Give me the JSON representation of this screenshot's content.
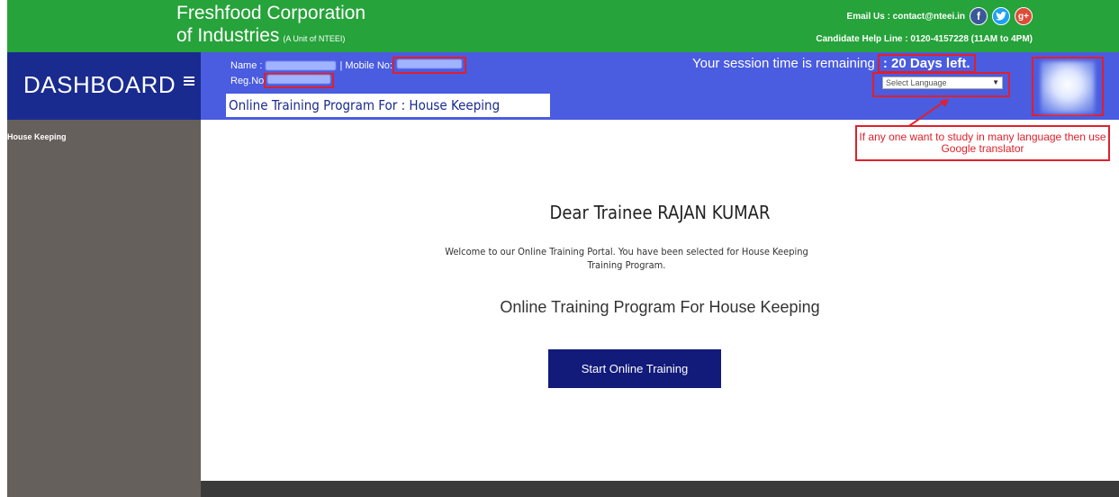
{
  "brand": {
    "line1": "Freshfood Corporation",
    "line2": "of Industries",
    "unit": "(A Unit of NTEEI)"
  },
  "contact": {
    "email": "Email Us : contact@nteei.in",
    "helpline": "Candidate Help Line : 0120-4157228 (11AM to 4PM)",
    "social_icons": [
      "facebook-icon",
      "twitter-icon",
      "google-plus-icon"
    ]
  },
  "header": {
    "dashboard_title": "DASHBOARD",
    "name_label": "Name :",
    "mobile_label": "| Mobile No:",
    "reg_label": "Reg.No",
    "program_line": "Online Training Program For : House Keeping",
    "session_text": "Your session time is remaining",
    "session_days": ": 20 Days left.",
    "language_select": "Select Language"
  },
  "annotation": {
    "text": "If any one want to study in many language then use Google translator"
  },
  "sidebar": {
    "items": [
      {
        "label": "House Keeping"
      }
    ]
  },
  "main": {
    "greeting": "Dear Trainee RAJAN KUMAR",
    "welcome": "Welcome to our Online Training Portal. You have been selected for House Keeping Training Program.",
    "program": "Online Training Program For House Keeping",
    "start_button": "Start Online Training"
  },
  "colors": {
    "topbar": "#26a33a",
    "bluebar": "#4a5ce0",
    "dashboard_block": "#1a2b8f",
    "sidebar": "#66605d",
    "button": "#121a7a",
    "highlight": "#e0202a"
  }
}
